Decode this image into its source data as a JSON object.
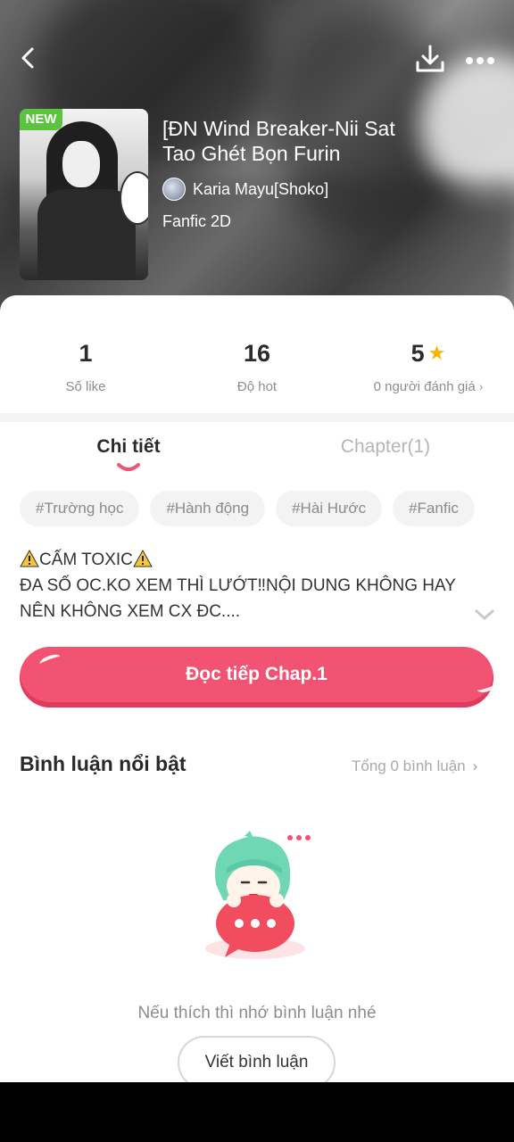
{
  "header": {
    "back_icon": "chevron-left-icon",
    "download_icon": "download-icon",
    "more_icon": "more-dots-icon"
  },
  "story": {
    "badge": "NEW",
    "title": "[ĐN Wind Breaker-Nii Sat Tao Ghét Bọn Furin",
    "author": "Karia Mayu[Shoko]",
    "genre": "Fanfic 2D"
  },
  "stats": [
    {
      "value": "1",
      "label": "Số like"
    },
    {
      "value": "16",
      "label": "Độ hot"
    },
    {
      "value": "5",
      "label": "0 người đánh giá"
    }
  ],
  "tabs": [
    {
      "label": "Chi tiết"
    },
    {
      "label": "Chapter(1)"
    }
  ],
  "tags": [
    "#Trường học",
    "#Hành động",
    "#Hài Hước",
    "#Fanfic"
  ],
  "description": {
    "line1": "CẤM TOXIC",
    "line2": "ĐA SỐ OC.KO XEM THÌ LƯỚT‼NỘI DUNG KHÔNG HAY",
    "line3": "NÊN KHÔNG XEM CX ĐC...."
  },
  "read_button": "Đọc tiếp Chap.1",
  "comments": {
    "title": "Bình luận nổi bật",
    "total": "Tổng 0 bình luận",
    "empty_hint": "Nếu thích thì nhớ bình luận nhé",
    "write_button": "Viết bình luận"
  },
  "colors": {
    "accent": "#f25373",
    "new_badge": "#5cc33e",
    "star": "#f5b400"
  }
}
